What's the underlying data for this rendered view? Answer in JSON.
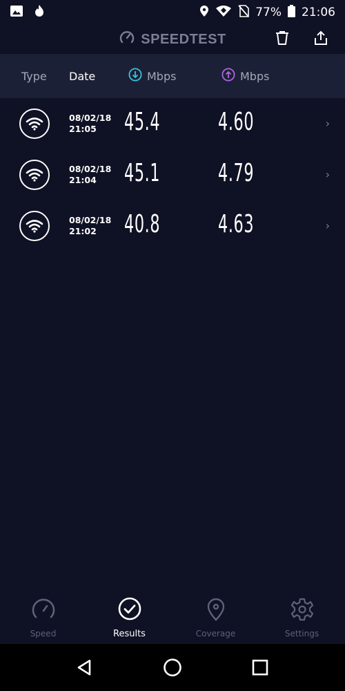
{
  "status_bar": {
    "battery": "77%",
    "time": "21:06"
  },
  "header": {
    "brand": "SPEEDTEST"
  },
  "columns": {
    "type": "Type",
    "date": "Date",
    "download": "Mbps",
    "upload": "Mbps"
  },
  "results": [
    {
      "date": "08/02/18",
      "time": "21:05",
      "download": "45.4",
      "upload": "4.60"
    },
    {
      "date": "08/02/18",
      "time": "21:04",
      "download": "45.1",
      "upload": "4.79"
    },
    {
      "date": "08/02/18",
      "time": "21:02",
      "download": "40.8",
      "upload": "4.63"
    }
  ],
  "tabs": [
    {
      "label": "Speed"
    },
    {
      "label": "Results"
    },
    {
      "label": "Coverage"
    },
    {
      "label": "Settings"
    }
  ],
  "colors": {
    "background": "#0f1124",
    "header_bar": "#1c2036",
    "download_accent": "#36c6d9",
    "upload_accent": "#b066e0",
    "muted": "#7c7f94"
  }
}
